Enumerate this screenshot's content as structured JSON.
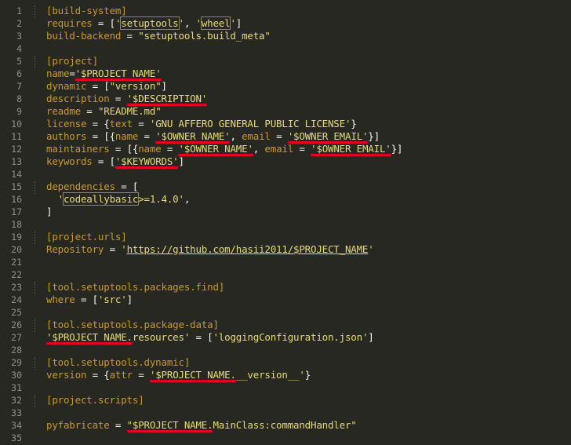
{
  "editor": {
    "lines": [
      {
        "n": "1",
        "tokens": [
          {
            "t": "[build-system]",
            "c": "k"
          }
        ]
      },
      {
        "n": "2",
        "tokens": [
          {
            "t": "requires",
            "c": "k"
          },
          {
            "t": " = [",
            "c": "p"
          },
          {
            "t": "'",
            "c": "s"
          },
          {
            "t": "setuptools",
            "c": "w"
          },
          {
            "t": "'",
            "c": "s"
          },
          {
            "t": ", ",
            "c": "p"
          },
          {
            "t": "'",
            "c": "s"
          },
          {
            "t": "wheel",
            "c": "w"
          },
          {
            "t": "'",
            "c": "s"
          },
          {
            "t": "]",
            "c": "p"
          }
        ]
      },
      {
        "n": "3",
        "tokens": [
          {
            "t": "build-backend",
            "c": "k"
          },
          {
            "t": " = ",
            "c": "p"
          },
          {
            "t": "\"setuptools.build_meta\"",
            "c": "s"
          }
        ]
      },
      {
        "n": "4",
        "tokens": []
      },
      {
        "n": "5",
        "tokens": [
          {
            "t": "[project]",
            "c": "k"
          }
        ]
      },
      {
        "n": "6",
        "tokens": [
          {
            "t": "name",
            "c": "k"
          },
          {
            "t": "=",
            "c": "p"
          },
          {
            "t": "'$PROJECT_NAME'",
            "c": "s"
          }
        ]
      },
      {
        "n": "7",
        "tokens": [
          {
            "t": "dynamic",
            "c": "k"
          },
          {
            "t": " = [",
            "c": "p"
          },
          {
            "t": "\"version\"",
            "c": "s"
          },
          {
            "t": "]",
            "c": "p"
          }
        ]
      },
      {
        "n": "8",
        "tokens": [
          {
            "t": "description",
            "c": "k"
          },
          {
            "t": " = ",
            "c": "p"
          },
          {
            "t": "'$DESCRIPTION'",
            "c": "s"
          }
        ]
      },
      {
        "n": "9",
        "tokens": [
          {
            "t": "readme",
            "c": "k"
          },
          {
            "t": " = ",
            "c": "p"
          },
          {
            "t": "\"README.md\"",
            "c": "s"
          }
        ]
      },
      {
        "n": "10",
        "tokens": [
          {
            "t": "license",
            "c": "k"
          },
          {
            "t": " = {",
            "c": "p"
          },
          {
            "t": "text",
            "c": "k"
          },
          {
            "t": " = ",
            "c": "p"
          },
          {
            "t": "'GNU AFFERO GENERAL PUBLIC LICENSE'",
            "c": "s"
          },
          {
            "t": "}",
            "c": "p"
          }
        ]
      },
      {
        "n": "11",
        "tokens": [
          {
            "t": "authors",
            "c": "k"
          },
          {
            "t": " = [{",
            "c": "p"
          },
          {
            "t": "name",
            "c": "k"
          },
          {
            "t": " = ",
            "c": "p"
          },
          {
            "t": "'$OWNER_NAME'",
            "c": "s"
          },
          {
            "t": ", ",
            "c": "p"
          },
          {
            "t": "email",
            "c": "k"
          },
          {
            "t": " = ",
            "c": "p"
          },
          {
            "t": "'$OWNER_EMAIL'",
            "c": "s"
          },
          {
            "t": "}]",
            "c": "p"
          }
        ]
      },
      {
        "n": "12",
        "tokens": [
          {
            "t": "maintainers",
            "c": "k"
          },
          {
            "t": " = [{",
            "c": "p"
          },
          {
            "t": "name",
            "c": "k"
          },
          {
            "t": " = ",
            "c": "p"
          },
          {
            "t": "'$OWNER_NAME'",
            "c": "s"
          },
          {
            "t": ", ",
            "c": "p"
          },
          {
            "t": "email",
            "c": "k"
          },
          {
            "t": " = ",
            "c": "p"
          },
          {
            "t": "'$OWNER_EMAIL'",
            "c": "s"
          },
          {
            "t": "}]",
            "c": "p"
          }
        ]
      },
      {
        "n": "13",
        "tokens": [
          {
            "t": "keywords",
            "c": "k"
          },
          {
            "t": " = [",
            "c": "p"
          },
          {
            "t": "'$KEYWORDS'",
            "c": "s"
          },
          {
            "t": "]",
            "c": "p"
          }
        ]
      },
      {
        "n": "14",
        "tokens": []
      },
      {
        "n": "15",
        "tokens": [
          {
            "t": "dependencies",
            "c": "k"
          },
          {
            "t": " = [",
            "c": "p"
          }
        ]
      },
      {
        "n": "16",
        "tokens": [
          {
            "t": "  ",
            "c": "p"
          },
          {
            "t": "'",
            "c": "s"
          },
          {
            "t": "codeallybasic",
            "c": "w"
          },
          {
            "t": ">=1.4.0'",
            "c": "s"
          },
          {
            "t": ",",
            "c": "p"
          }
        ]
      },
      {
        "n": "17",
        "tokens": [
          {
            "t": "]",
            "c": "p"
          }
        ]
      },
      {
        "n": "18",
        "tokens": []
      },
      {
        "n": "19",
        "tokens": [
          {
            "t": "[project.urls]",
            "c": "k"
          }
        ]
      },
      {
        "n": "20",
        "tokens": [
          {
            "t": "Repository",
            "c": "k"
          },
          {
            "t": " = ",
            "c": "p"
          },
          {
            "t": "'",
            "c": "s"
          },
          {
            "t": "https://github.com/hasii2011/$PROJECT_NAME",
            "c": "u"
          },
          {
            "t": "'",
            "c": "s"
          }
        ]
      },
      {
        "n": "21",
        "tokens": []
      },
      {
        "n": "22",
        "tokens": []
      },
      {
        "n": "23",
        "tokens": [
          {
            "t": "[tool.setuptools.packages.find]",
            "c": "k"
          }
        ]
      },
      {
        "n": "24",
        "tokens": [
          {
            "t": "where",
            "c": "k"
          },
          {
            "t": " = [",
            "c": "p"
          },
          {
            "t": "'src'",
            "c": "s"
          },
          {
            "t": "]",
            "c": "p"
          }
        ]
      },
      {
        "n": "25",
        "tokens": []
      },
      {
        "n": "26",
        "tokens": [
          {
            "t": "[tool.setuptools.package-data]",
            "c": "k"
          }
        ]
      },
      {
        "n": "27",
        "tokens": [
          {
            "t": "'$PROJECT_NAME.resources'",
            "c": "s"
          },
          {
            "t": " = [",
            "c": "p"
          },
          {
            "t": "'loggingConfiguration.json'",
            "c": "s"
          },
          {
            "t": "]",
            "c": "p"
          }
        ]
      },
      {
        "n": "28",
        "tokens": []
      },
      {
        "n": "29",
        "tokens": [
          {
            "t": "[tool.setuptools.dynamic]",
            "c": "k"
          }
        ]
      },
      {
        "n": "30",
        "tokens": [
          {
            "t": "version",
            "c": "k"
          },
          {
            "t": " = {",
            "c": "p"
          },
          {
            "t": "attr",
            "c": "k"
          },
          {
            "t": " = ",
            "c": "p"
          },
          {
            "t": "'$PROJECT_NAME.__version__'",
            "c": "s"
          },
          {
            "t": "}",
            "c": "p"
          }
        ]
      },
      {
        "n": "31",
        "tokens": []
      },
      {
        "n": "32",
        "tokens": [
          {
            "t": "[project.scripts]",
            "c": "k"
          }
        ]
      },
      {
        "n": "33",
        "tokens": []
      },
      {
        "n": "34",
        "tokens": [
          {
            "t": "pyfabricate",
            "c": "k"
          },
          {
            "t": " = ",
            "c": "p"
          },
          {
            "t": "\"$PROJECT_NAME.MainClass:commandHandler\"",
            "c": "s"
          }
        ]
      },
      {
        "n": "35",
        "tokens": []
      }
    ]
  },
  "colors": {
    "background": "#272822",
    "line_number": "#8f908a",
    "key": "#c69a2c",
    "string": "#e6db74",
    "punctuation": "#f8f8f2",
    "annotation_underline": "#e1001f"
  }
}
